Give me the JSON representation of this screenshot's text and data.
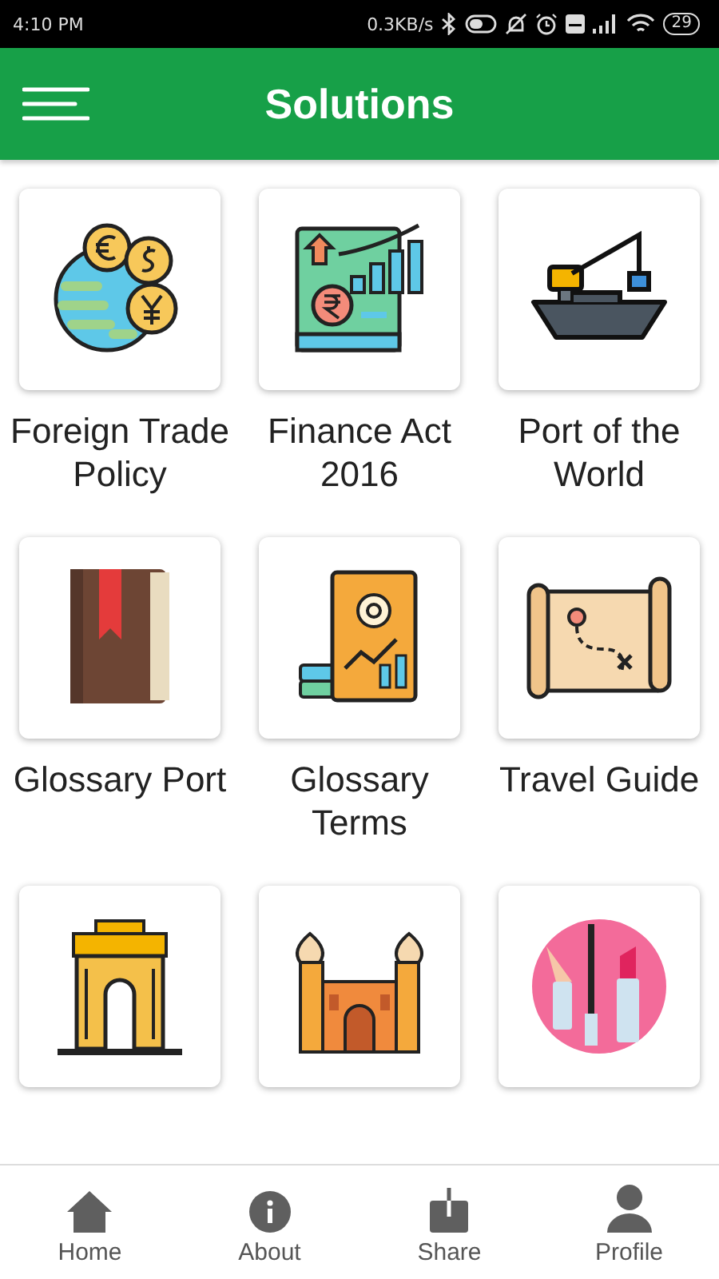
{
  "status_bar": {
    "time": "4:10 PM",
    "speed": "0.3KB/s",
    "battery": "29"
  },
  "header": {
    "title": "Solutions"
  },
  "tiles": [
    {
      "kind": "currency",
      "label": "Foreign Trade Policy"
    },
    {
      "kind": "finance",
      "label": "Finance Act 2016"
    },
    {
      "kind": "ship",
      "label": "Port of the World"
    },
    {
      "kind": "book",
      "label": "Glossary Port"
    },
    {
      "kind": "report",
      "label": "Glossary Terms"
    },
    {
      "kind": "map",
      "label": "Travel Guide"
    },
    {
      "kind": "gate"
    },
    {
      "kind": "palace"
    },
    {
      "kind": "makeup"
    }
  ],
  "nav": [
    {
      "kind": "home",
      "label": "Home"
    },
    {
      "kind": "about",
      "label": "About"
    },
    {
      "kind": "share",
      "label": "Share"
    },
    {
      "kind": "profile",
      "label": "Profile"
    }
  ]
}
